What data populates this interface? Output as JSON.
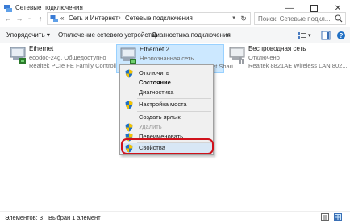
{
  "window": {
    "title": "Сетевые подключения",
    "controls": [
      "minimize-icon",
      "maximize-icon",
      "close-icon"
    ]
  },
  "address": {
    "breadcrumb": [
      "«",
      "Сеть и Интернет",
      "Сетевые подключения"
    ],
    "search_placeholder": "Поиск: Сетевые подкл..."
  },
  "toolbar": {
    "organize": "Упорядочить ▾",
    "disable_device": "Отключение сетевого устройства",
    "diagnose": "Диагностика подключения",
    "more": "»"
  },
  "connections": [
    {
      "name": "Ethernet",
      "status": "ecodoc-24g, Общедоступно",
      "adapter": "Realtek PCIe FE Family Controller",
      "selected": false
    },
    {
      "name": "Ethernet 2",
      "status": "Неопознанная сеть",
      "adapter": "Remote NDIS based Internet Shari...",
      "selected": true
    },
    {
      "name": "Беспроводная сеть",
      "status": "Отключено",
      "adapter": "Realtek 8821AE Wireless LAN 802....",
      "selected": false
    }
  ],
  "context_menu": {
    "disable": "Отключить",
    "status": "Состояние",
    "diagnostics": "Диагностика",
    "bridge": "Настройка моста",
    "shortcut": "Создать ярлык",
    "delete": "Удалить",
    "rename": "Переименовать",
    "properties": "Свойства"
  },
  "statusbar": {
    "items": "Элементов: 3",
    "selected": "Выбран 1 элемент"
  },
  "colors": {
    "selection": "#cce8ff",
    "highlight_ring": "#d0121b",
    "shield_blue": "#1f6fc4",
    "shield_yellow": "#f5c400"
  }
}
